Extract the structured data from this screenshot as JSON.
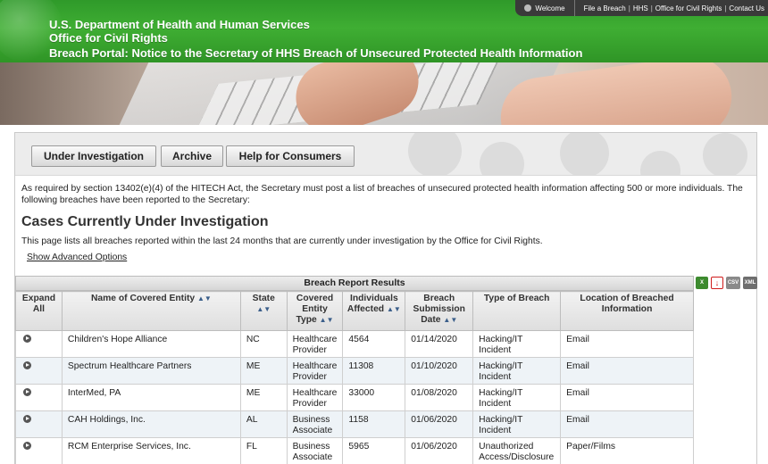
{
  "header": {
    "department": "U.S. Department of Health and Human Services",
    "office": "Office for Civil Rights",
    "portal_title": "Breach Portal: Notice to the Secretary of HHS Breach of Unsecured Protected Health Information"
  },
  "top_links": {
    "welcome": "Welcome",
    "links": [
      "File a Breach",
      "HHS",
      "Office for Civil Rights",
      "Contact Us"
    ]
  },
  "tabs": [
    {
      "label": "Under Investigation"
    },
    {
      "label": "Archive"
    },
    {
      "label": "Help for Consumers"
    }
  ],
  "intro": "As required by section 13402(e)(4) of the HITECH Act, the Secretary must post a list of breaches of unsecured protected health information affecting 500 or more individuals. The following breaches have been reported to the Secretary:",
  "page_title": "Cases Currently Under Investigation",
  "page_subtitle": "This page lists all breaches reported within the last 24 months that are currently under investigation by the Office for Civil Rights.",
  "advanced_options": "Show Advanced Options",
  "results": {
    "title": "Breach Report Results",
    "export_icons": [
      "excel-icon",
      "pdf-icon",
      "csv-icon",
      "xml-icon"
    ],
    "columns": [
      "Expand All",
      "Name of Covered Entity",
      "State",
      "Covered Entity Type",
      "Individuals Affected",
      "Breach Submission Date",
      "Type of Breach",
      "Location of Breached Information"
    ],
    "rows": [
      {
        "name": "Children's Hope Alliance",
        "state": "NC",
        "type": "Healthcare Provider",
        "affected": "4564",
        "date": "01/14/2020",
        "breach": "Hacking/IT Incident",
        "location": "Email"
      },
      {
        "name": "Spectrum Healthcare Partners",
        "state": "ME",
        "type": "Healthcare Provider",
        "affected": "11308",
        "date": "01/10/2020",
        "breach": "Hacking/IT Incident",
        "location": "Email"
      },
      {
        "name": "InterMed, PA",
        "state": "ME",
        "type": "Healthcare Provider",
        "affected": "33000",
        "date": "01/08/2020",
        "breach": "Hacking/IT Incident",
        "location": "Email"
      },
      {
        "name": "CAH Holdings, Inc.",
        "state": "AL",
        "type": "Business Associate",
        "affected": "1158",
        "date": "01/06/2020",
        "breach": "Hacking/IT Incident",
        "location": "Email"
      },
      {
        "name": "RCM Enterprise Services, Inc.",
        "state": "FL",
        "type": "Business Associate",
        "affected": "5965",
        "date": "01/06/2020",
        "breach": "Unauthorized Access/Disclosure",
        "location": "Paper/Films"
      }
    ]
  }
}
